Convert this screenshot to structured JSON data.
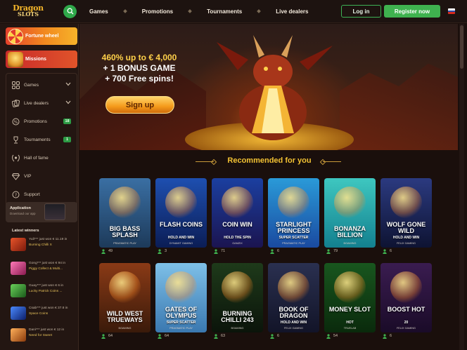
{
  "header": {
    "logo_line1": "Dragon",
    "logo_line2": "SLOTS",
    "nav": [
      "Games",
      "Promotions",
      "Tournaments",
      "Live dealers"
    ],
    "login_label": "Log in",
    "register_label": "Register now"
  },
  "sidebar": {
    "promos": [
      {
        "label": "Fortune wheel"
      },
      {
        "label": "Missions"
      }
    ],
    "menu": [
      {
        "label": "Games",
        "icon": "games-icon",
        "chevron": true
      },
      {
        "label": "Live dealers",
        "icon": "live-dealer-icon",
        "chevron": true
      },
      {
        "label": "Promotions",
        "icon": "promotions-icon",
        "badge": "18"
      },
      {
        "label": "Tournaments",
        "icon": "tournament-icon",
        "badge": "1"
      },
      {
        "label": "Hall of fame",
        "icon": "laurel-icon"
      },
      {
        "label": "VIP",
        "icon": "diamond-icon"
      },
      {
        "label": "Support",
        "icon": "support-icon"
      }
    ],
    "app": {
      "title": "Application",
      "subtitle": "Download our app"
    },
    "winners_title": "Latest winners",
    "winners": [
      {
        "line1": "Yuli*** just won € 11.19 in",
        "game": "Burning Chilli X",
        "color": "#c0392b"
      },
      {
        "line1": "Gong*** just won € 94 in",
        "game": "Piggy Collect & Multi...",
        "color": "#e84393"
      },
      {
        "line1": "Guay*** just won € 6 in",
        "game": "Lucky Patrick Coins ...",
        "color": "#27ae60"
      },
      {
        "line1": "Csab*** just won € 37.8 in",
        "game": "Space Coins",
        "color": "#2c5fd6"
      },
      {
        "line1": "Dani*** just won € 12 in",
        "game": "Need for Sweet",
        "color": "#d35400"
      }
    ]
  },
  "hero": {
    "line1_highlight": "460% up to € 4,000",
    "line2": "+ 1 BONUS GAME",
    "line3": "+ 700 Free spins!",
    "button": "Sign up"
  },
  "recommended": {
    "title": "Recommended for you",
    "games": [
      {
        "name": "BIG BASS SPLASH",
        "sub": "",
        "provider": "PRAGMATIC PLAY",
        "players": "49",
        "bg1": "#3a6fa3",
        "bg2": "#1d3a5a"
      },
      {
        "name": "FLASH COINS",
        "sub": "HOLD AND WIN",
        "provider": "DYNAMIT GAMING",
        "players": "3",
        "bg1": "#1e4fb0",
        "bg2": "#0b1d55"
      },
      {
        "name": "COIN WIN",
        "sub": "HOLD THE SPIN",
        "provider": "GAMZIX",
        "players": "71",
        "bg1": "#1b3fa0",
        "bg2": "#1b1450"
      },
      {
        "name": "STARLIGHT PRINCESS",
        "sub": "SUPER SCATTER",
        "provider": "PRAGMATIC PLAY",
        "players": "6",
        "bg1": "#2a9ad8",
        "bg2": "#1a4aa0"
      },
      {
        "name": "BONANZA BILLION",
        "sub": "",
        "provider": "BGAMING",
        "players": "79",
        "bg1": "#3ec7c0",
        "bg2": "#13808f"
      },
      {
        "name": "WOLF GONE WILD",
        "sub": "HOLD AND WIN",
        "provider": "FELIX GAMING",
        "players": "6",
        "bg1": "#2b3a80",
        "bg2": "#0e1332"
      },
      {
        "name": "WILD WEST TRUEWAYS",
        "sub": "",
        "provider": "BGAMING",
        "players": "64",
        "bg1": "#8a3a16",
        "bg2": "#3a1a0a"
      },
      {
        "name": "GATES OF OLYMPUS",
        "sub": "SUPER SCATTER",
        "provider": "PRAGMATIC PLAY",
        "players": "64",
        "bg1": "#7ec0e8",
        "bg2": "#3a78b0"
      },
      {
        "name": "BURNING CHILLI 243",
        "sub": "",
        "provider": "BGAMING",
        "players": "63",
        "bg1": "#1e3a1a",
        "bg2": "#0b140a"
      },
      {
        "name": "BOOK OF DRAGON",
        "sub": "HOLD AND WIN",
        "provider": "FELIX GAMING",
        "players": "6",
        "bg1": "#2a3050",
        "bg2": "#121428"
      },
      {
        "name": "MONEY SLOT",
        "sub": "HOT",
        "provider": "TRUELAB",
        "players": "54",
        "bg1": "#18561e",
        "bg2": "#0a2a0c"
      },
      {
        "name": "BOOST HOT",
        "sub": "20",
        "provider": "FELIX GAMING",
        "players": "6",
        "bg1": "#3a1c50",
        "bg2": "#1a0b28"
      }
    ]
  },
  "colors": {
    "accent_green": "#3fb24f",
    "accent_gold": "#f3c233",
    "background": "#1a0f0c"
  }
}
